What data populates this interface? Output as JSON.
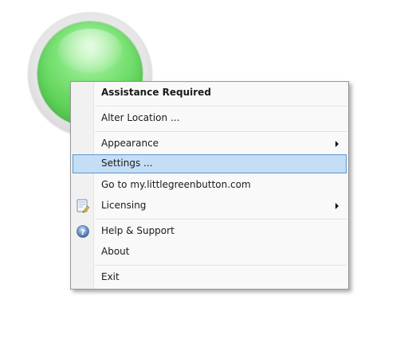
{
  "menu": {
    "header": "Assistance Required",
    "items": [
      {
        "label": "Alter Location ..."
      },
      {
        "label": "Appearance",
        "has_submenu": true
      },
      {
        "label": "Settings ...",
        "selected": true
      },
      {
        "label": "Go to my.littlegreenbutton.com"
      },
      {
        "label": "Licensing",
        "has_submenu": true,
        "icon": "license-icon"
      },
      {
        "label": "Help & Support",
        "icon": "help-icon"
      },
      {
        "label": "About"
      },
      {
        "label": "Exit"
      }
    ]
  },
  "colors": {
    "selection_bg": "#c4def6",
    "selection_border": "#5a96cf",
    "button_green": "#5fd259"
  }
}
